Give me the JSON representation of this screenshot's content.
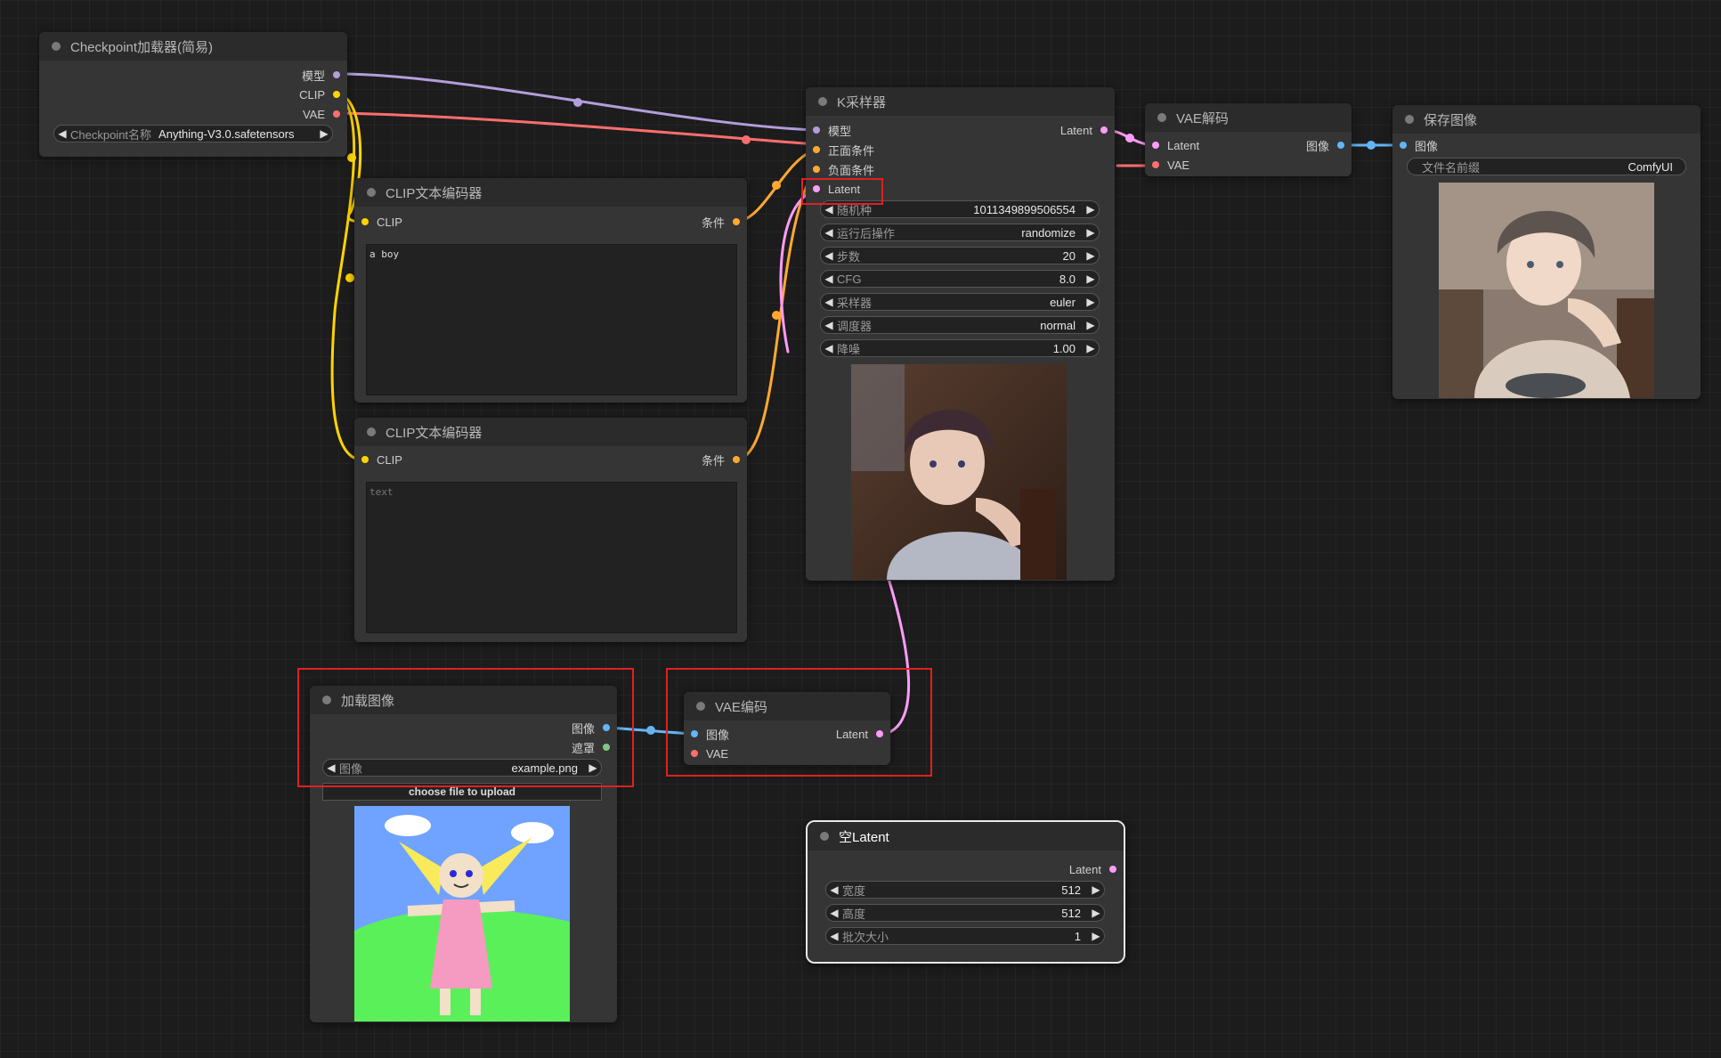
{
  "colors": {
    "model": "#b39ddb",
    "clip": "#ffd500",
    "vae": "#ff6e6e",
    "conditioning": "#ffa931",
    "latent": "#ff9cf9",
    "image": "#64b5f6",
    "mask": "#81c784",
    "highlight": "#e02020"
  },
  "nodes": {
    "checkpoint": {
      "title": "Checkpoint加载器(简易)",
      "outputs": [
        "模型",
        "CLIP",
        "VAE"
      ],
      "widget": {
        "label": "Checkpoint名称",
        "value": "Anything-V3.0.safetensors"
      }
    },
    "clip_pos": {
      "title": "CLIP文本编码器",
      "input": "CLIP",
      "output": "条件",
      "text": "a boy"
    },
    "clip_neg": {
      "title": "CLIP文本编码器",
      "input": "CLIP",
      "output": "条件",
      "placeholder": "text"
    },
    "ksampler": {
      "title": "K采样器",
      "inputs": [
        "模型",
        "正面条件",
        "负面条件",
        "Latent"
      ],
      "output": "Latent",
      "widgets": [
        {
          "label": "随机种",
          "value": "1011349899506554"
        },
        {
          "label": "运行后操作",
          "value": "randomize"
        },
        {
          "label": "步数",
          "value": "20"
        },
        {
          "label": "CFG",
          "value": "8.0"
        },
        {
          "label": "采样器",
          "value": "euler"
        },
        {
          "label": "调度器",
          "value": "normal"
        },
        {
          "label": "降噪",
          "value": "1.00"
        }
      ]
    },
    "vae_decode": {
      "title": "VAE解码",
      "inputs": [
        "Latent",
        "VAE"
      ],
      "output": "图像"
    },
    "save_image": {
      "title": "保存图像",
      "input": "图像",
      "widget": {
        "label": "文件名前缀",
        "value": "ComfyUI"
      }
    },
    "load_image": {
      "title": "加载图像",
      "outputs": [
        "图像",
        "遮罩"
      ],
      "widget": {
        "label": "图像",
        "value": "example.png"
      },
      "upload_label": "choose file to upload"
    },
    "vae_encode": {
      "title": "VAE编码",
      "inputs": [
        "图像",
        "VAE"
      ],
      "output": "Latent"
    },
    "empty_latent": {
      "title": "空Latent",
      "output": "Latent",
      "widgets": [
        {
          "label": "宽度",
          "value": "512"
        },
        {
          "label": "高度",
          "value": "512"
        },
        {
          "label": "批次大小",
          "value": "1"
        }
      ]
    }
  }
}
